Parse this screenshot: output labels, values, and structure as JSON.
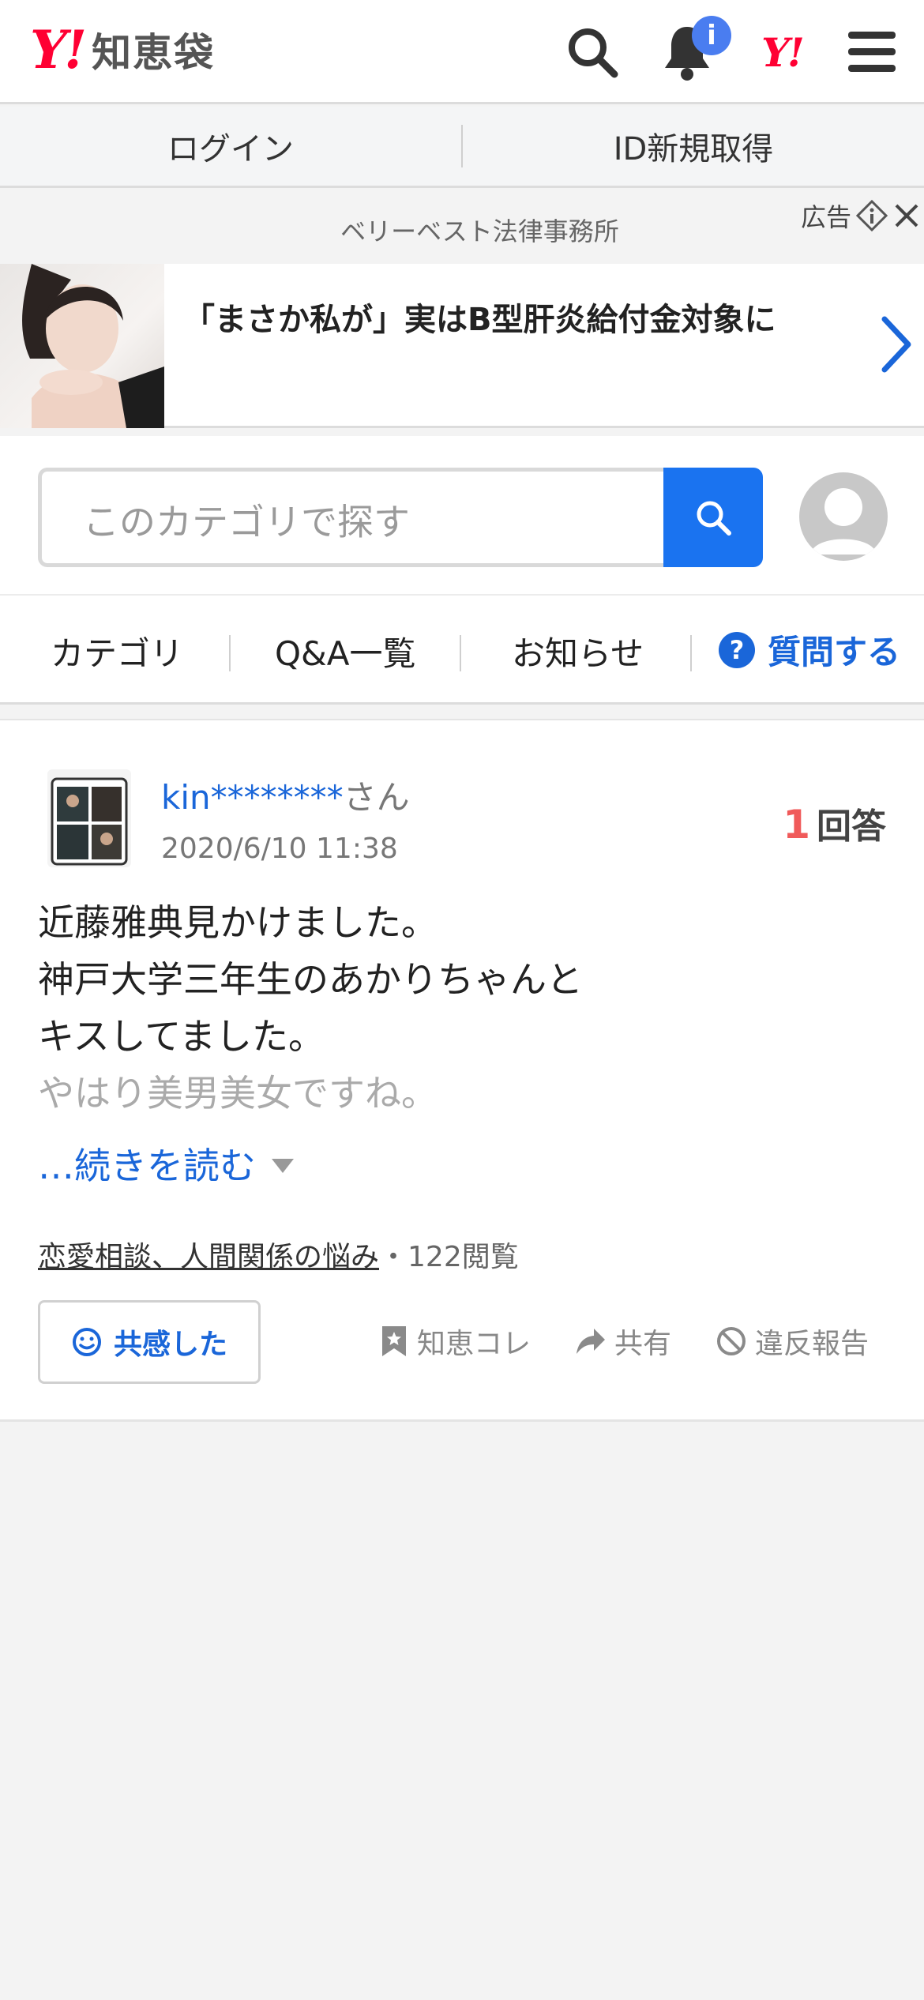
{
  "header": {
    "logo_mark": "Y!",
    "logo_text": "知恵袋",
    "notification_count": "i",
    "yahoo_mark": "Y!"
  },
  "auth": {
    "login": "ログイン",
    "register": "ID新規取得"
  },
  "ad": {
    "sponsor": "ベリーベスト法律事務所",
    "label": "広告",
    "title": "「まさか私が」実はB型肝炎給付金対象に"
  },
  "search": {
    "placeholder": "このカテゴリで探す"
  },
  "nav": {
    "category": "カテゴリ",
    "qa_list": "Q&A一覧",
    "news": "お知らせ",
    "ask": "質問する",
    "ask_icon": "?"
  },
  "question": {
    "user": "kin********",
    "honorific": "さん",
    "date": "2020/6/10 11:38",
    "answer_count": "1",
    "answer_label": "回答",
    "lines": [
      "近藤雅典見かけました。",
      "神戸大学三年生のあかりちゃんと",
      "キスしてました。"
    ],
    "fade_line": "やはり美男美女ですね。",
    "read_more": "…続きを読む",
    "category": "恋愛相談、人間関係の悩み",
    "views": "・122閲覧",
    "empathy": "共感した",
    "collect": "知恵コレ",
    "share": "共有",
    "report": "違反報告"
  },
  "colors": {
    "accent": "#1a66d9",
    "brand": "#ff0033",
    "search_button": "#1a73f0",
    "answer_count": "#f05a5a"
  }
}
